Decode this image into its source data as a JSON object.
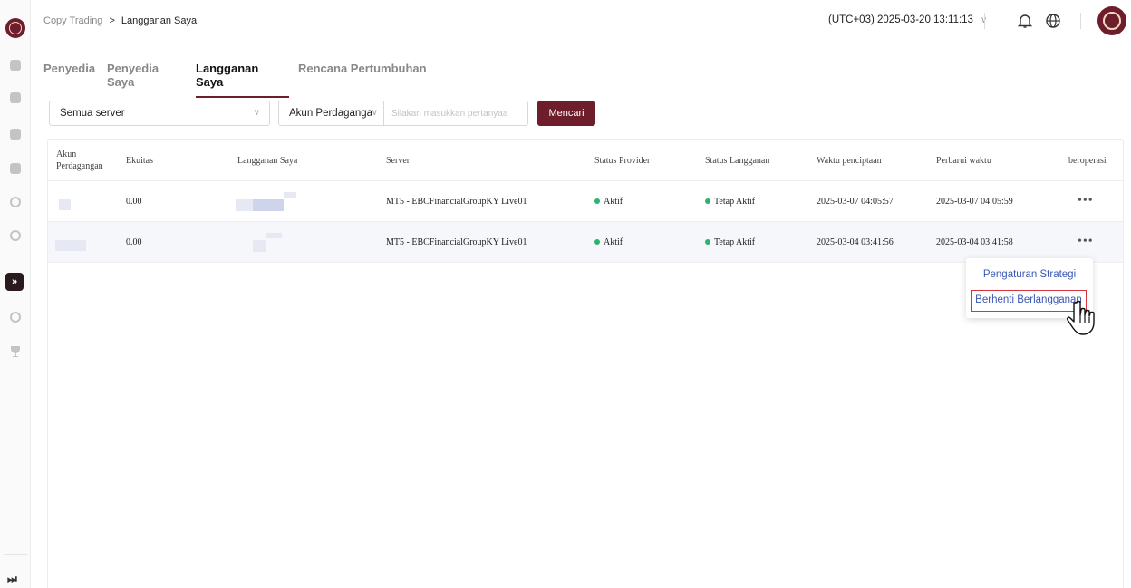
{
  "breadcrumb": {
    "root": "Copy Trading",
    "separator": ">",
    "current": "Langganan Saya"
  },
  "header": {
    "timezone": "(UTC+03)",
    "datetime": "2025-03-20 13:11:13"
  },
  "tabs": [
    {
      "label": "Penyedia"
    },
    {
      "label": "Penyedia Saya"
    },
    {
      "label": "Langganan Saya"
    },
    {
      "label": "Rencana Pertumbuhan"
    }
  ],
  "filters": {
    "server_select": "Semua server",
    "account_type": "Akun Perdaganga",
    "search_placeholder": "Silakan masukkan pertanyaa",
    "search_button": "Mencari"
  },
  "table": {
    "columns": {
      "account_line1": "Akun",
      "account_line2": "Perdagangan",
      "equity": "Ekuitas",
      "subscription": "Langganan Saya",
      "server": "Server",
      "provider_status": "Status Provider",
      "subscription_status": "Status Langganan",
      "created": "Waktu penciptaan",
      "updated": "Perbarui waktu",
      "operate": "beroperasi"
    },
    "rows": [
      {
        "equity": "0.00",
        "server": "MT5 - EBCFinancialGroupKY Live01",
        "provider_status": "Aktif",
        "subscription_status": "Tetap Aktif",
        "created": "2025-03-07 04:05:57",
        "updated": "2025-03-07 04:05:59",
        "more": "•••"
      },
      {
        "equity": "0.00",
        "server": "MT5 - EBCFinancialGroupKY Live01",
        "provider_status": "Aktif",
        "subscription_status": "Tetap Aktif",
        "created": "2025-03-04 03:41:56",
        "updated": "2025-03-04 03:41:58",
        "more": "•••"
      }
    ]
  },
  "dropdown": {
    "items": [
      "Pengaturan Strategi",
      "Berhenti Berlangganan"
    ]
  },
  "colors": {
    "brand": "#6e1d2a",
    "status_active": "#2db36f",
    "link": "#3a57b4",
    "highlight_border": "#d9333f"
  }
}
